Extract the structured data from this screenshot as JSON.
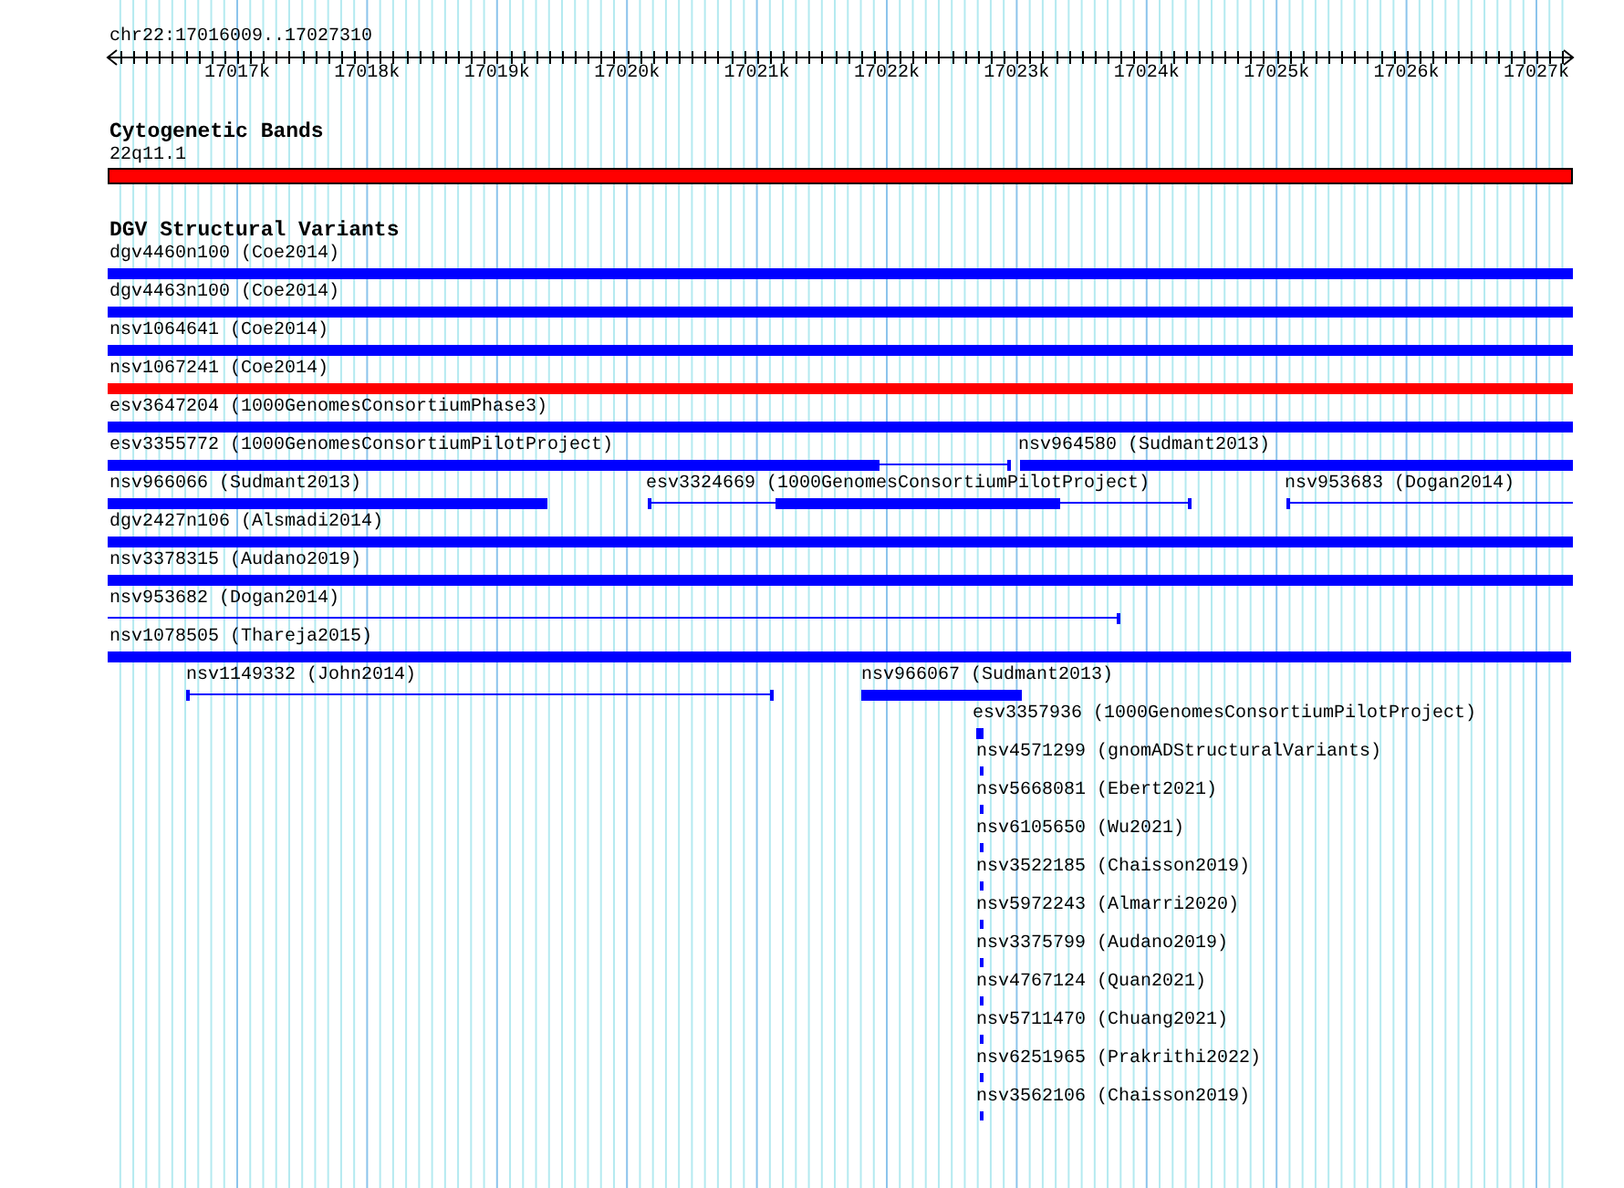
{
  "location": "chr22:17016009..17027310",
  "ruler": {
    "ticks": [
      "17017k",
      "17018k",
      "17019k",
      "17020k",
      "17021k",
      "17022k",
      "17023k",
      "17024k",
      "17025k",
      "17026k",
      "17027k"
    ]
  },
  "tracks": [
    {
      "title": "Cytogenetic Bands",
      "features": [
        {
          "label": "22q11.1",
          "kind": "band",
          "color": "#ff0000"
        }
      ]
    },
    {
      "title": "DGV Structural Variants",
      "features": [
        {
          "label": "dgv4460n100 (Coe2014)",
          "kind": "block",
          "color": "#0000ff"
        },
        {
          "label": "dgv4463n100 (Coe2014)",
          "kind": "block",
          "color": "#0000ff"
        },
        {
          "label": "nsv1064641 (Coe2014)",
          "kind": "block",
          "color": "#0000ff"
        },
        {
          "label": "nsv1067241 (Coe2014)",
          "kind": "block",
          "color": "#ff0000"
        },
        {
          "label": "esv3647204 (1000GenomesConsortiumPhase3)",
          "kind": "block",
          "color": "#0000ff"
        },
        {
          "label": "esv3355772 (1000GenomesConsortiumPilotProject)",
          "kind": "gapped",
          "color": "#0000ff"
        },
        {
          "label": "nsv964580 (Sudmant2013)",
          "kind": "block",
          "color": "#0000ff"
        },
        {
          "label": "nsv966066 (Sudmant2013)",
          "kind": "block",
          "color": "#0000ff"
        },
        {
          "label": "esv3324669 (1000GenomesConsortiumPilotProject)",
          "kind": "gapped",
          "color": "#0000ff"
        },
        {
          "label": "nsv953683 (Dogan2014)",
          "kind": "line",
          "color": "#0000ff"
        },
        {
          "label": "dgv2427n106 (Alsmadi2014)",
          "kind": "block",
          "color": "#0000ff"
        },
        {
          "label": "nsv3378315 (Audano2019)",
          "kind": "block",
          "color": "#0000ff"
        },
        {
          "label": "nsv953682 (Dogan2014)",
          "kind": "line",
          "color": "#0000ff"
        },
        {
          "label": "nsv1078505 (Thareja2015)",
          "kind": "block",
          "color": "#0000ff"
        },
        {
          "label": "nsv1149332 (John2014)",
          "kind": "line",
          "color": "#0000ff"
        },
        {
          "label": "nsv966067 (Sudmant2013)",
          "kind": "block",
          "color": "#0000ff"
        },
        {
          "label": "esv3357936 (1000GenomesConsortiumPilotProject)",
          "kind": "block",
          "color": "#0000ff"
        },
        {
          "label": "nsv4571299 (gnomADStructuralVariants)",
          "kind": "block",
          "color": "#0000ff"
        },
        {
          "label": "nsv5668081 (Ebert2021)",
          "kind": "block",
          "color": "#0000ff"
        },
        {
          "label": "nsv6105650 (Wu2021)",
          "kind": "block",
          "color": "#0000ff"
        },
        {
          "label": "nsv3522185 (Chaisson2019)",
          "kind": "block",
          "color": "#0000ff"
        },
        {
          "label": "nsv5972243 (Almarri2020)",
          "kind": "block",
          "color": "#0000ff"
        },
        {
          "label": "nsv3375799 (Audano2019)",
          "kind": "block",
          "color": "#0000ff"
        },
        {
          "label": "nsv4767124 (Quan2021)",
          "kind": "block",
          "color": "#0000ff"
        },
        {
          "label": "nsv5711470 (Chuang2021)",
          "kind": "block",
          "color": "#0000ff"
        },
        {
          "label": "nsv6251965 (Prakrithi2022)",
          "kind": "block",
          "color": "#0000ff"
        },
        {
          "label": "nsv3562106 (Chaisson2019)",
          "kind": "block",
          "color": "#0000ff"
        }
      ]
    }
  ]
}
